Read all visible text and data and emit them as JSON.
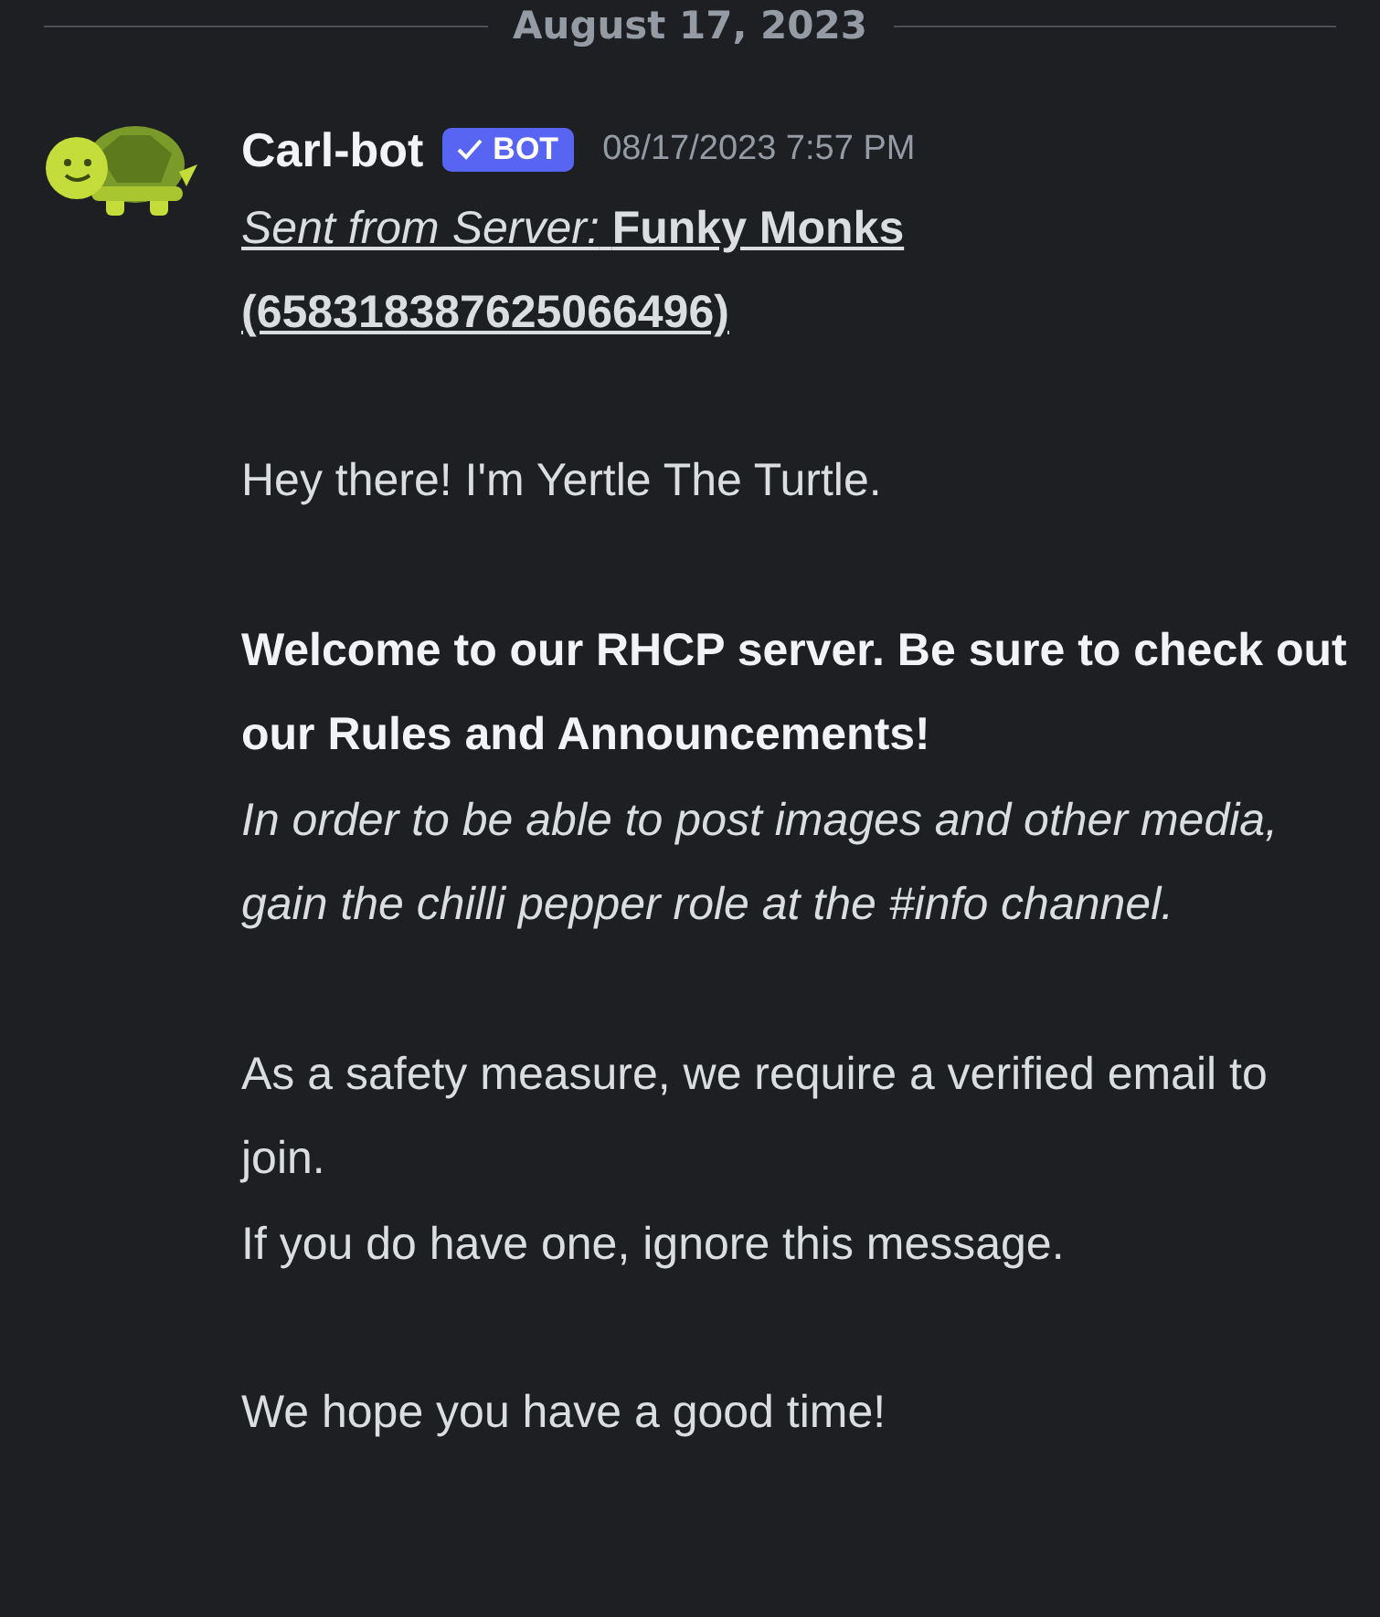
{
  "date_divider": "August 17, 2023",
  "message": {
    "author": "Carl-bot",
    "badge": "BOT",
    "timestamp": "08/17/2023 7:57 PM",
    "link": "*Sent from Server:* **Funky Monks (658318387625066496)**",
    "blocks": [
      {
        "lines": [
          {
            "kind": "plain",
            "text": "Hey there! I'm Yertle The Turtle."
          }
        ]
      },
      {
        "lines": [
          {
            "kind": "bold",
            "text": "Welcome to our RHCP server. Be sure to check out our Rules and Announcements!"
          },
          {
            "kind": "italic",
            "text": "In order to be able to post images and other media, gain the chilli pepper role at the #info channel."
          }
        ]
      },
      {
        "lines": [
          {
            "kind": "plain",
            "text": "As a safety measure, we require a verified email to join."
          },
          {
            "kind": "plain",
            "text": "If you do have one, ignore this message."
          }
        ]
      },
      {
        "lines": [
          {
            "kind": "plain",
            "text": "We hope you have a good time!"
          }
        ]
      }
    ]
  }
}
